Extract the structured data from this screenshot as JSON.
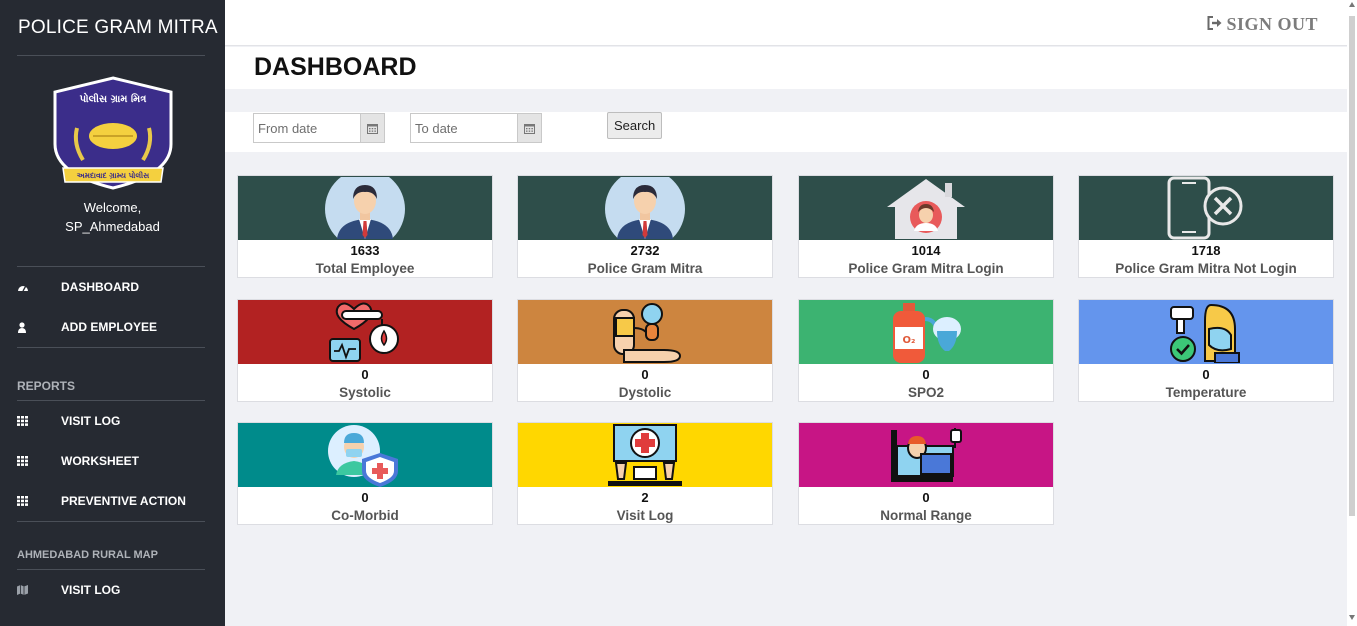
{
  "sidebar": {
    "brand": "POLICE GRAM MITRA",
    "logo": {
      "top_text": "પોલીસ ગ્રામ મિત્ર",
      "ribbon_text": "અમદાવાદ ગ્રામ્ય પોલીસ"
    },
    "welcome_line1": "Welcome,",
    "welcome_line2": "SP_Ahmedabad",
    "nav": [
      {
        "label": "DASHBOARD",
        "icon": "dashboard-icon"
      },
      {
        "label": "ADD EMPLOYEE",
        "icon": "user-icon"
      }
    ],
    "reports_title": "REPORTS",
    "reports": [
      {
        "label": "VISIT LOG",
        "icon": "grid-icon"
      },
      {
        "label": "WORKSHEET",
        "icon": "grid-icon"
      },
      {
        "label": "PREVENTIVE ACTION",
        "icon": "grid-icon"
      }
    ],
    "map_title": "AHMEDABAD RURAL MAP",
    "map_items": [
      {
        "label": "VISIT LOG",
        "icon": "map-icon"
      }
    ]
  },
  "header": {
    "signout_label": "SIGN OUT",
    "signout_icon": "sign-out-icon"
  },
  "page": {
    "title": "DASHBOARD"
  },
  "filters": {
    "from_placeholder": "From date",
    "to_placeholder": "To date",
    "search_label": "Search"
  },
  "colors": {
    "sidebar_bg": "#262a32",
    "dark_teal": "#2e4e4a",
    "red": "#b22222",
    "orange": "#cd853f",
    "green": "#3cb371",
    "blue": "#6495ed",
    "teal": "#008b8b",
    "yellow": "#ffd700",
    "magenta": "#c71585"
  },
  "cards": [
    {
      "count": "1633",
      "label": "Total Employee",
      "icon": "employee-avatar-icon",
      "color": "#2e4e4a"
    },
    {
      "count": "2732",
      "label": "Police Gram Mitra",
      "icon": "employee-avatar-icon",
      "color": "#2e4e4a"
    },
    {
      "count": "1014",
      "label": "Police Gram Mitra Login",
      "icon": "home-user-icon",
      "color": "#2e4e4a"
    },
    {
      "count": "1718",
      "label": "Police Gram Mitra Not Login",
      "icon": "phone-cancel-icon",
      "color": "#2e4e4a"
    },
    {
      "count": "0",
      "label": "Systolic",
      "icon": "blood-pressure-monitor-icon",
      "color": "#b22222"
    },
    {
      "count": "0",
      "label": "Dystolic",
      "icon": "blood-pressure-arm-icon",
      "color": "#cd853f"
    },
    {
      "count": "0",
      "label": "SPO2",
      "icon": "oxygen-cylinder-icon",
      "color": "#3cb371"
    },
    {
      "count": "0",
      "label": "Temperature",
      "icon": "thermometer-gun-icon",
      "color": "#6495ed"
    },
    {
      "count": "0",
      "label": "Co-Morbid",
      "icon": "doctor-shield-icon",
      "color": "#008b8b"
    },
    {
      "count": "2",
      "label": "Visit Log",
      "icon": "medical-station-icon",
      "color": "#ffd700"
    },
    {
      "count": "0",
      "label": "Normal Range",
      "icon": "hospital-bed-icon",
      "color": "#c71585"
    }
  ]
}
